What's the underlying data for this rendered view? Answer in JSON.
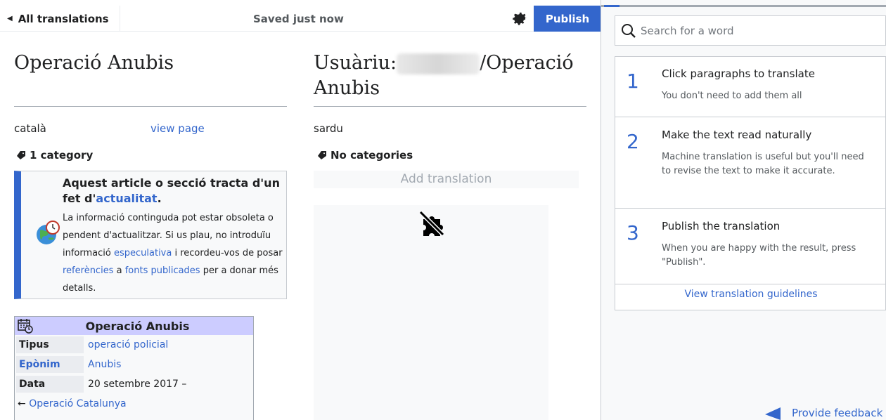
{
  "toolbar": {
    "back_label": "All translations",
    "saved_status": "Saved just now",
    "settings_icon": "gear-icon",
    "publish_label": "Publish"
  },
  "source": {
    "title": "Operació Anubis",
    "language": "català",
    "view_page_link": "view page",
    "category_label": "1 category",
    "notice": {
      "title_prefix": "Aquest article o secció tracta d'un fet d'",
      "title_link": "actualitat",
      "title_suffix": ".",
      "body": [
        {
          "t": "La informació continguda pot estar obsoleta o pendent d'actualitzar. Si us plau, no introduïu informació ",
          "link": false
        },
        {
          "t": "especulativa",
          "link": true
        },
        {
          "t": " i recordeu-vos de posar ",
          "link": false
        },
        {
          "t": "referències",
          "link": true
        },
        {
          "t": " a ",
          "link": false
        },
        {
          "t": "fonts publicades",
          "link": true
        },
        {
          "t": " per a donar més detalls.",
          "link": false
        }
      ]
    },
    "infobox": {
      "title": "Operació Anubis",
      "rows": [
        {
          "key": "Tipus",
          "value": "operació policial",
          "key_link": false,
          "value_link": true
        },
        {
          "key": "Epònim",
          "value": "Anubis",
          "key_link": true,
          "value_link": true
        },
        {
          "key": "Data",
          "value": "20 setembre 2017 –",
          "key_link": false,
          "value_link": false
        }
      ],
      "prev_arrow": "←",
      "prev_link": "Operació Catalunya"
    }
  },
  "target": {
    "title_prefix": "Usuàriu:",
    "title_suffix": "/Operació Anubis",
    "language": "sardu",
    "category_label": "No categories",
    "add_translation_placeholder": "Add translation"
  },
  "sidebar": {
    "search_placeholder": "Search for a word",
    "steps": [
      {
        "num": "1",
        "title": "Click paragraphs to translate",
        "desc": "You don't need to add them all"
      },
      {
        "num": "2",
        "title": "Make the text read naturally",
        "desc": "Machine translation is useful but you'll need to revise the text to make it accurate."
      },
      {
        "num": "3",
        "title": "Publish the translation",
        "desc": "When you are happy with the result, press \"Publish\"."
      }
    ],
    "guidelines_link": "View translation guidelines",
    "feedback_link": "Provide feedback"
  },
  "colors": {
    "accent": "#3366cc",
    "infobox_header": "#ccccff",
    "panel_bg": "#f8f9fa"
  }
}
